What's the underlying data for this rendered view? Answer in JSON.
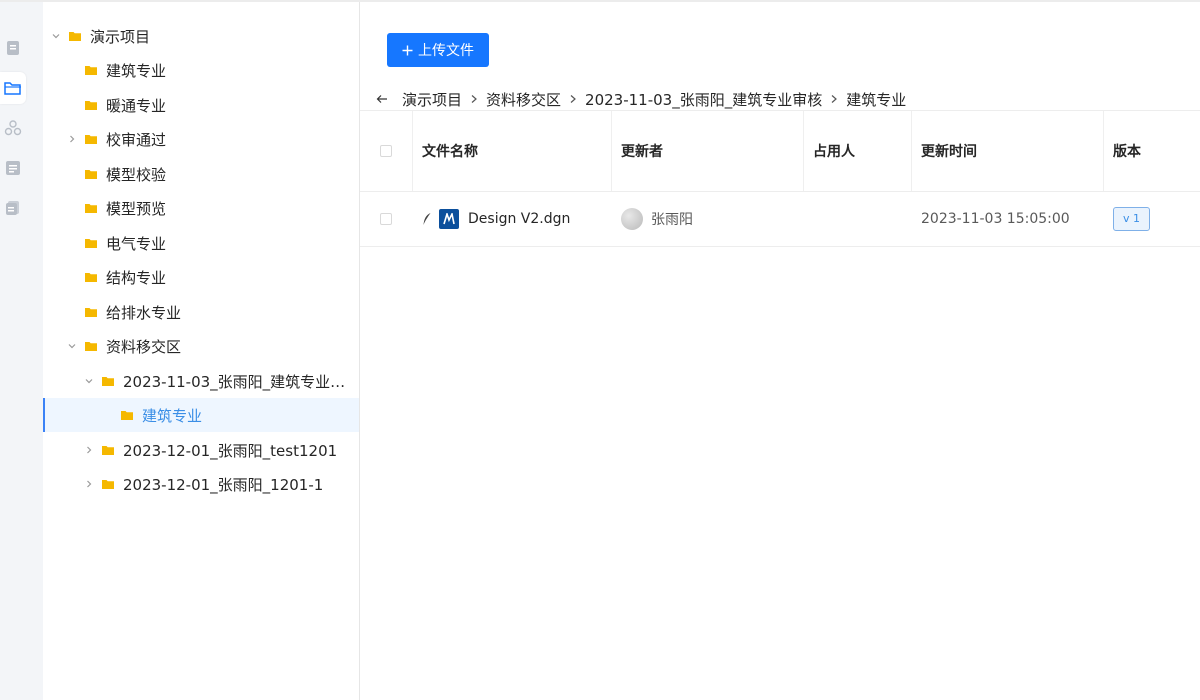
{
  "rail": {
    "items": [
      {
        "icon": "document-icon",
        "active": false
      },
      {
        "icon": "folder-open-icon",
        "active": true
      },
      {
        "icon": "hierarchy-icon",
        "active": false
      },
      {
        "icon": "list-doc-icon",
        "active": false
      },
      {
        "icon": "stacked-doc-icon",
        "active": false
      }
    ],
    "accent": "#1677ff"
  },
  "tree": {
    "folder_color": "#f5b800",
    "nodes": [
      {
        "label": "演示项目",
        "level": 0,
        "caret": "down"
      },
      {
        "label": "建筑专业",
        "level": 1,
        "caret": "none"
      },
      {
        "label": "暖通专业",
        "level": 1,
        "caret": "none"
      },
      {
        "label": "校审通过",
        "level": 1,
        "caret": "right"
      },
      {
        "label": "模型校验",
        "level": 1,
        "caret": "none"
      },
      {
        "label": "模型预览",
        "level": 1,
        "caret": "none"
      },
      {
        "label": "电气专业",
        "level": 1,
        "caret": "none"
      },
      {
        "label": "结构专业",
        "level": 1,
        "caret": "none"
      },
      {
        "label": "给排水专业",
        "level": 1,
        "caret": "none"
      },
      {
        "label": "资料移交区",
        "level": 1,
        "caret": "down"
      },
      {
        "label": "2023-11-03_张雨阳_建筑专业审...",
        "level": 2,
        "caret": "down"
      },
      {
        "label": "建筑专业",
        "level": 3,
        "caret": "none",
        "selected": true
      },
      {
        "label": "2023-12-01_张雨阳_test1201",
        "level": 2,
        "caret": "right"
      },
      {
        "label": "2023-12-01_张雨阳_1201-1",
        "level": 2,
        "caret": "right"
      }
    ]
  },
  "toolbar": {
    "upload_label": "上传文件",
    "upload_color": "#1677ff"
  },
  "breadcrumb": {
    "items": [
      "演示项目",
      "资料移交区",
      "2023-11-03_张雨阳_建筑专业审核",
      "建筑专业"
    ]
  },
  "table": {
    "columns": [
      "文件名称",
      "更新者",
      "占用人",
      "更新时间",
      "版本"
    ],
    "rows": [
      {
        "file_name": "Design V2.dgn",
        "updater": "张雨阳",
        "occupant": "",
        "updated_at": "2023-11-03 15:05:00",
        "version": "v 1"
      }
    ]
  }
}
